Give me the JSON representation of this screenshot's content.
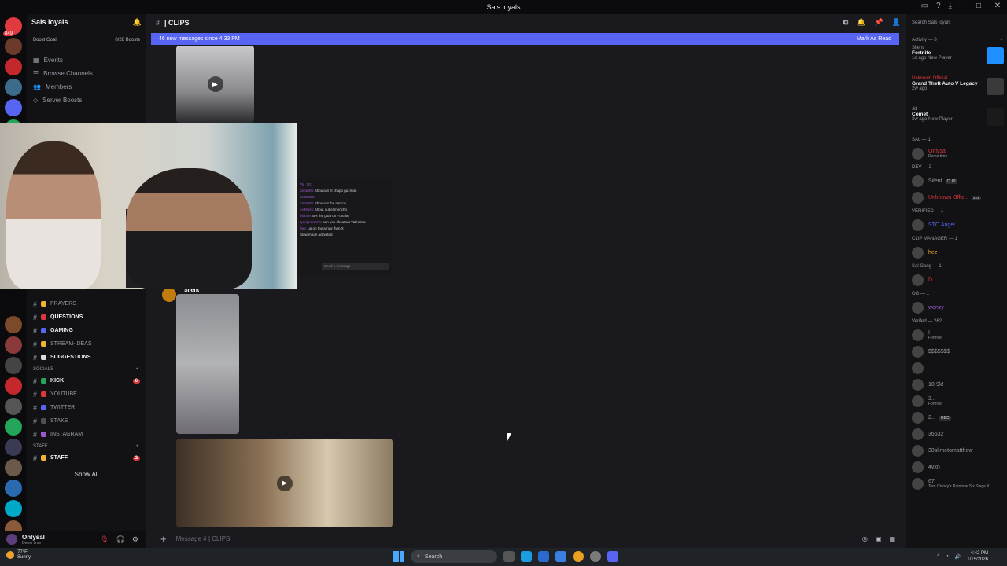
{
  "titlebar": {
    "title": "Sals loyals"
  },
  "server_badges": [
    "849",
    "",
    "",
    "",
    ""
  ],
  "sidebar": {
    "guild_name": "Sals loyals",
    "boost_goal": "Boost Goal",
    "boost_count": "0/28 Boosts",
    "static_items": [
      "Events",
      "Browse Channels",
      "Members",
      "Server Boosts"
    ],
    "channels": [
      {
        "name": "PRAYERS",
        "bold": false,
        "color": "#f0b232"
      },
      {
        "name": "QUESTIONS",
        "bold": true,
        "color": "#da373c"
      },
      {
        "name": "GAMING",
        "bold": true,
        "color": "#5865f2"
      },
      {
        "name": "STREAM-IDEAS",
        "bold": false,
        "color": "#f0b232"
      },
      {
        "name": "SUGGESTIONS",
        "bold": true,
        "color": "#dbdee1"
      }
    ],
    "socials_label": "SOCIALS",
    "socials": [
      {
        "name": "KICK",
        "bold": true,
        "color": "#23a55a",
        "badge": "6"
      },
      {
        "name": "YOUTUBE",
        "bold": false,
        "color": "#da373c",
        "badge": ""
      },
      {
        "name": "TWITTER",
        "bold": false,
        "color": "#5865f2",
        "badge": ""
      },
      {
        "name": "STAKE",
        "bold": false,
        "color": "#4e5058",
        "badge": ""
      },
      {
        "name": "INSTAGRAM",
        "bold": false,
        "color": "#9b59d0",
        "badge": ""
      }
    ],
    "staff_label": "STAFF",
    "staff": {
      "name": "STAFF",
      "badge": "2"
    },
    "show_all": "Show All"
  },
  "user": {
    "name": "Onlysal",
    "status": "Demo time"
  },
  "channel": {
    "name": "| CLIPS",
    "new_messages": "46 new messages since 4:33 PM",
    "mark_read": "Mark As Read",
    "composer_placeholder": "Message #",
    "composer_channel": "| CLIPS",
    "author": "Silent"
  },
  "stream_chat": {
    "lines": [
      {
        "user": "Vix_10:",
        "text": ""
      },
      {
        "user": "Xera005:",
        "text": "shoutout el chapo guzman"
      },
      {
        "user": "Seda005:",
        "text": ""
      },
      {
        "user": "Xera005:",
        "text": "shoutout the narcos"
      },
      {
        "user": "4x89bex:",
        "text": "shout out el mencho"
      },
      {
        "user": "ef0bde:",
        "text": "BH the goat on Fortnite"
      },
      {
        "user": "ryanjordawnn:",
        "text": "can you shoutout Valentina"
      },
      {
        "user": "lljas:",
        "text": "up on the arrow then X"
      },
      {
        "user": "",
        "text": "Slow mode activated"
      }
    ],
    "send_placeholder": "Send a message"
  },
  "members": {
    "search_placeholder": "Search Sals loyals",
    "activity_label": "Activity — 8",
    "activities": [
      {
        "user": "Silent",
        "game": "Fortnite",
        "time": "1d ago",
        "tag": "New Player",
        "thumb": "#1e90ff",
        "user_color": "#949ba4"
      },
      {
        "user": "Unknown Official",
        "game": "Grand Theft Auto V Legacy",
        "time": "2w ago",
        "tag": "",
        "thumb": "#3a3a3a",
        "user_color": "#da373c"
      },
      {
        "user": "Jd",
        "game": "Comet",
        "time": "3w ago",
        "tag": "New Player",
        "thumb": "#1a1a1a",
        "user_color": "#949ba4"
      }
    ],
    "groups": [
      {
        "label": "SAL — 1",
        "members": [
          {
            "name": "Onlysal",
            "sub": "Demo time",
            "color": "#da373c"
          }
        ]
      },
      {
        "label": "DEV — 2",
        "members": [
          {
            "name": "Silent",
            "sub": "",
            "color": "#949ba4",
            "tag": "CLIP"
          },
          {
            "name": "Unknown Offic...",
            "sub": "",
            "color": "#da373c",
            "tag": "zzz"
          }
        ]
      },
      {
        "label": "VERIFIED — 1",
        "members": [
          {
            "name": "STO Angel",
            "sub": "",
            "color": "#5865f2"
          }
        ]
      },
      {
        "label": "CLIP MANAGER — 1",
        "members": [
          {
            "name": "hez",
            "sub": "",
            "color": "#f0b232"
          }
        ]
      },
      {
        "label": "Sal Gang — 1",
        "members": [
          {
            "name": "D",
            "sub": "",
            "color": "#da373c"
          }
        ]
      },
      {
        "label": "OG — 1",
        "members": [
          {
            "name": "wenzy",
            "sub": "",
            "color": "#9b59d0"
          }
        ]
      },
      {
        "label": "Verifed — 262",
        "members": [
          {
            "name": "!",
            "sub": "Fortnite",
            "color": "#949ba4"
          },
          {
            "name": "$$$$$$$",
            "sub": "",
            "color": "#949ba4"
          },
          {
            "name": ".",
            "sub": "",
            "color": "#949ba4"
          },
          {
            "name": "10-9k!",
            "sub": "",
            "color": "#949ba4"
          },
          {
            "name": "2...",
            "sub": "Fortnite",
            "color": "#949ba4"
          },
          {
            "name": "2...",
            "sub": "",
            "color": "#949ba4",
            "tag": "OBC"
          },
          {
            "name": "36632",
            "sub": "",
            "color": "#949ba4"
          },
          {
            "name": "38slimetomatthew",
            "sub": "",
            "color": "#949ba4"
          },
          {
            "name": "4vxn",
            "sub": "",
            "color": "#949ba4"
          },
          {
            "name": "67",
            "sub": "Tom Clancy's Rainbow Six Siege X",
            "color": "#949ba4"
          }
        ]
      }
    ]
  },
  "taskbar": {
    "weather_temp": "77°F",
    "weather_cond": "Sunny",
    "search": "Search",
    "time": "4:42 PM",
    "date": "1/15/2026"
  }
}
